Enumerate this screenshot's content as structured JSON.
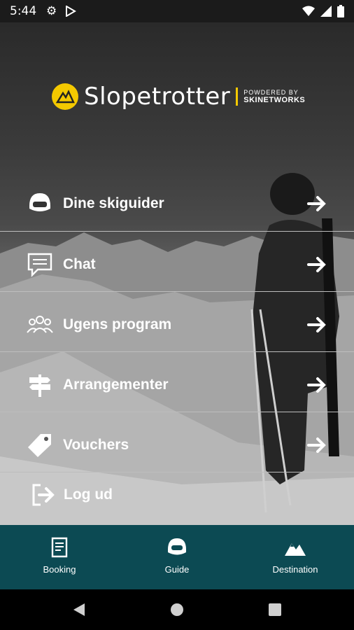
{
  "status_bar": {
    "time": "5:44"
  },
  "logo": {
    "name": "Slopetrotter",
    "powered_line1": "POWDERED BY",
    "powered_line2": "SKINETWORKS",
    "accent_color": "#f4c900"
  },
  "menu": {
    "items": [
      {
        "label": "Dine skiguider",
        "icon": "skier-helmet-icon"
      },
      {
        "label": "Chat",
        "icon": "chat-bubble-icon"
      },
      {
        "label": "Ugens program",
        "icon": "group-icon"
      },
      {
        "label": "Arrangementer",
        "icon": "signpost-icon"
      },
      {
        "label": "Vouchers",
        "icon": "tag-icon"
      },
      {
        "label": "Log ud",
        "icon": "logout-icon"
      }
    ]
  },
  "bottom_nav": {
    "background": "#0c4a53",
    "tabs": [
      {
        "label": "Booking",
        "icon": "document-icon"
      },
      {
        "label": "Guide",
        "icon": "helmet-icon",
        "selected": true
      },
      {
        "label": "Destination",
        "icon": "mountain-icon"
      }
    ]
  }
}
